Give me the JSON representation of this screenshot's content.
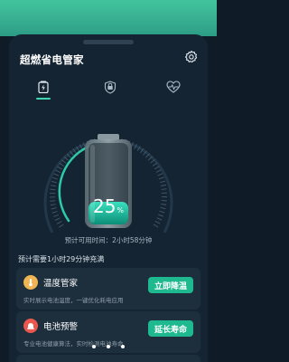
{
  "app": {
    "title": "超燃省电管家"
  },
  "icons": {
    "settings": "gear-icon",
    "tabs": [
      "battery-icon",
      "shield-icon",
      "heart-rate-icon"
    ]
  },
  "colors": {
    "accent": "#1fb98f",
    "header_green": "#3bb596",
    "background": "#142433",
    "card": "#1d2e3d"
  },
  "battery": {
    "percent_value": 25,
    "percent": "25",
    "unit": "%",
    "available_time": "预计可用时间：2小时58分钟"
  },
  "charge_estimate": "预计需要1小时29分钟充满",
  "cards": [
    {
      "title": "温度管家",
      "desc": "实时展示电池温度，一键优化耗电应用",
      "button": "立即降温",
      "icon": "thermometer-icon"
    },
    {
      "title": "电池预警",
      "desc": "专业电池健康算法，实时检测电池寿命",
      "button": "延长寿命",
      "icon": "alarm-icon"
    }
  ]
}
